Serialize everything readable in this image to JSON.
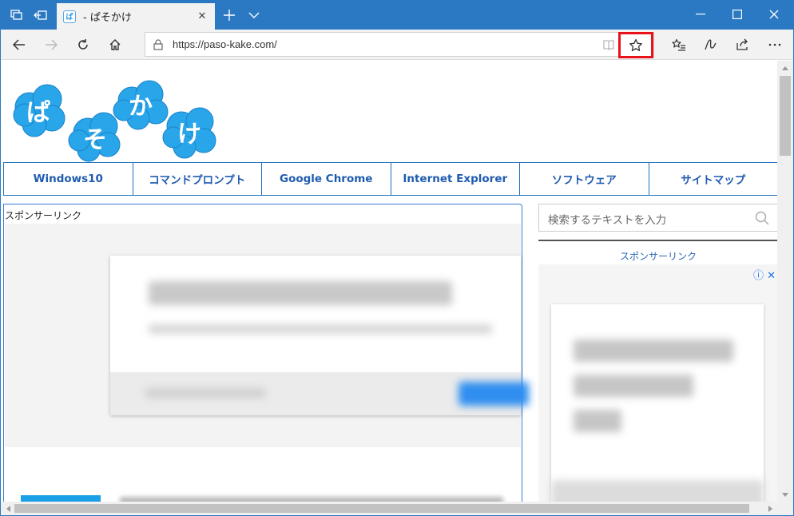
{
  "tab": {
    "favicon": "ぱ",
    "title": "- ぱそかけ",
    "close": "✕"
  },
  "browser": {
    "url": "https://paso-kake.com/",
    "icons": {
      "tab_manager": "tabs-icon",
      "set_aside": "set-aside-tabs-icon",
      "new_tab": "plus-icon",
      "tab_menu": "chevron-down-icon",
      "back": "back-arrow-icon",
      "forward": "forward-arrow-icon",
      "refresh": "refresh-icon",
      "home": "home-icon",
      "reading_view": "reading-view-icon",
      "favorite": "star-icon",
      "favorites_hub": "favorites-list-icon",
      "notes": "pen-icon",
      "share": "share-icon",
      "more": "more-icon"
    },
    "highlight_color": "#e8121b",
    "accent_color": "#2b79c2"
  },
  "site": {
    "logo_chars": [
      "ぱ",
      "そ",
      "か",
      "け"
    ],
    "nav": [
      "Windows10",
      "コマンドプロンプト",
      "Google Chrome",
      "Internet Explorer",
      "ソフトウェア",
      "サイトマップ"
    ],
    "sponsor_label": "スポンサーリンク",
    "search_placeholder": "検索するテキストを入力",
    "side_sponsor_label": "スポンサーリンク",
    "ad_choices": "ⓘ ✕"
  }
}
